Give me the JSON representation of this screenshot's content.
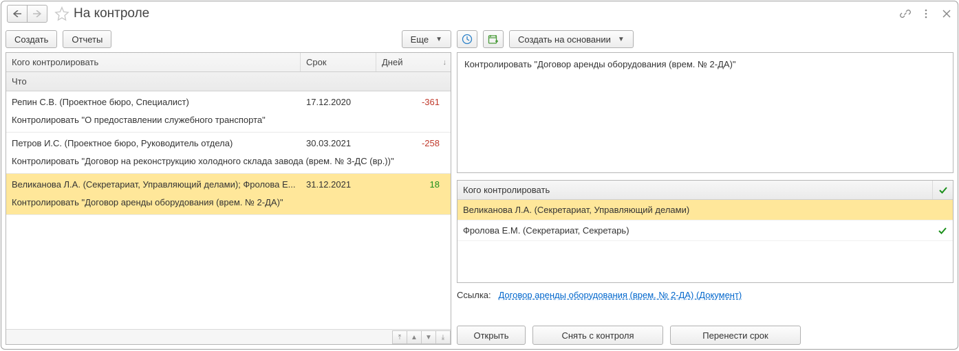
{
  "title": "На контроле",
  "toolbar": {
    "create": "Создать",
    "reports": "Отчеты",
    "more": "Еще",
    "create_based_on": "Создать на основании"
  },
  "left_table": {
    "headers": {
      "who": "Кого контролировать",
      "deadline": "Срок",
      "days": "Дней",
      "what": "Что"
    },
    "rows": [
      {
        "who": "Репин С.В. (Проектное бюро, Специалист)",
        "deadline": "17.12.2020",
        "days": "-361",
        "days_sign": "neg",
        "what": "Контролировать \"О предоставлении служебного транспорта\"",
        "selected": false
      },
      {
        "who": "Петров И.С. (Проектное бюро, Руководитель отдела)",
        "deadline": "30.03.2021",
        "days": "-258",
        "days_sign": "neg",
        "what": "Контролировать \"Договор на реконструкцию холодного склада завода (врем. № 3-ДС (вр.))\"",
        "selected": false
      },
      {
        "who": "Великанова Л.А. (Секретариат, Управляющий делами); Фролова Е...",
        "deadline": "31.12.2021",
        "days": "18",
        "days_sign": "pos",
        "what": "Контролировать \"Договор аренды оборудования (врем. № 2-ДА)\"",
        "selected": true
      }
    ]
  },
  "detail": {
    "description": "Контролировать \"Договор аренды оборудования (врем. № 2-ДА)\"",
    "controllers_header": "Кого контролировать",
    "controllers": [
      {
        "name": "Великанова Л.А. (Секретариат, Управляющий делами)",
        "done": false,
        "selected": true
      },
      {
        "name": "Фролова Е.М. (Секретариат, Секретарь)",
        "done": true,
        "selected": false
      }
    ],
    "link_label": "Ссылка:",
    "link_text": "Договор аренды оборудования (врем. № 2-ДА) (Документ)"
  },
  "right_buttons": {
    "open": "Открыть",
    "remove": "Снять с контроля",
    "postpone": "Перенести срок"
  }
}
